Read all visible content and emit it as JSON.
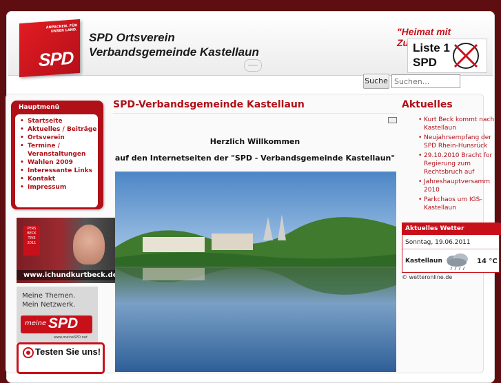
{
  "header": {
    "logo_slogan": "ANPACKEN. FÜR UNSER LAND.",
    "logo_text": "SPD",
    "title_line1": "SPD Ortsverein",
    "title_line2": "Verbandsgemeinde Kastellaun",
    "motto": "\"Heimat mit Zukunft\"",
    "ballot_line1": "Liste 1",
    "ballot_line2": "SPD"
  },
  "search": {
    "button_label": "Suche",
    "placeholder": "Suchen..."
  },
  "sidebar": {
    "menu_title": "Hauptmenü",
    "items": [
      {
        "label": "Startseite"
      },
      {
        "label": "Aktuelles / Beiträge"
      },
      {
        "label": "Ortsverein"
      },
      {
        "label": "Termine / Veranstaltungen"
      },
      {
        "label": "Wahlen 2009"
      },
      {
        "label": "Interessante Links"
      },
      {
        "label": "Kontakt"
      },
      {
        "label": "Impressum"
      }
    ],
    "banner_beck_tag": "PERS BECK TIVE 2011",
    "banner_beck_url": "www.ichundkurtbeck.de",
    "banner_meine_line1": "Meine Themen.",
    "banner_meine_line2": "Mein Netzwerk.",
    "banner_meine_word": "meine",
    "banner_meine_spd": "SPD",
    "banner_meine_url": "www.meineSPD.net",
    "banner_testen": "Testen Sie uns!"
  },
  "main": {
    "title": "SPD-Verbandsgemeinde Kastellaun",
    "welcome_line1": "Herzlich Willkommen",
    "welcome_line2": "auf den Internetseiten der \"SPD - Verbandsgemeinde Kastellaun\""
  },
  "aktuelles": {
    "title": "Aktuelles",
    "items": [
      {
        "label": "Kurt Beck kommt nach\nKastellaun"
      },
      {
        "label": "Neujahrsempfang der\nSPD Rhein-Hunsrück"
      },
      {
        "label": "29.10.2010 Bracht for\nRegierung zum\nRechtsbruch auf"
      },
      {
        "label": "Jahreshauptversamm\n2010"
      },
      {
        "label": "Parkchaos um IGS-\nKastellaun"
      }
    ]
  },
  "weather": {
    "header": "Aktuelles Wetter",
    "date": "Sonntag, 19.06.2011",
    "town": "Kastellaun",
    "temp": "14 °C",
    "credit": "© wetteronline.de",
    "icon": "cloud-rain-icon"
  },
  "colors": {
    "brand_red": "#c8101a",
    "background": "#5e0d10"
  }
}
